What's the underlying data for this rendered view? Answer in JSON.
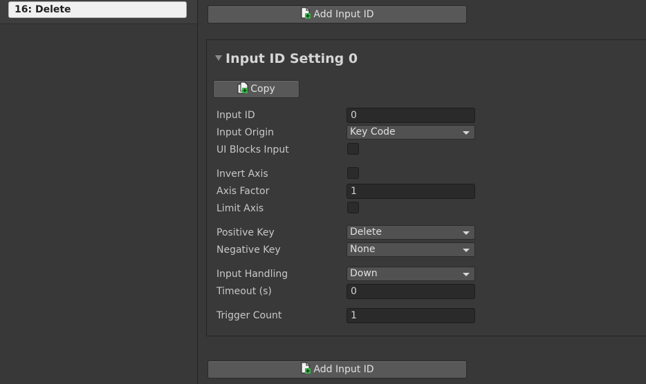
{
  "left_panel": {
    "selected_item": "16: Delete"
  },
  "toolbar": {
    "add_input_id_label": "Add Input ID"
  },
  "setting": {
    "title": "Input ID Setting 0",
    "copy_label": "Copy",
    "fields": {
      "input_id": {
        "label": "Input ID",
        "value": "0"
      },
      "input_origin": {
        "label": "Input Origin",
        "value": "Key Code"
      },
      "ui_blocks_input": {
        "label": "UI Blocks Input",
        "checked": false
      },
      "invert_axis": {
        "label": "Invert Axis",
        "checked": false
      },
      "axis_factor": {
        "label": "Axis Factor",
        "value": "1"
      },
      "limit_axis": {
        "label": "Limit Axis",
        "checked": false
      },
      "positive_key": {
        "label": "Positive Key",
        "value": "Delete"
      },
      "negative_key": {
        "label": "Negative Key",
        "value": "None"
      },
      "input_handling": {
        "label": "Input Handling",
        "value": "Down"
      },
      "timeout": {
        "label": "Timeout (s)",
        "value": "0"
      },
      "trigger_count": {
        "label": "Trigger Count",
        "value": "1"
      }
    }
  },
  "icons": {
    "add": "document-add-icon",
    "copy": "document-copy-icon"
  },
  "colors": {
    "accent_green": "#3cb44b",
    "field_bg": "#2a2a2a",
    "panel_bg": "#393939"
  }
}
